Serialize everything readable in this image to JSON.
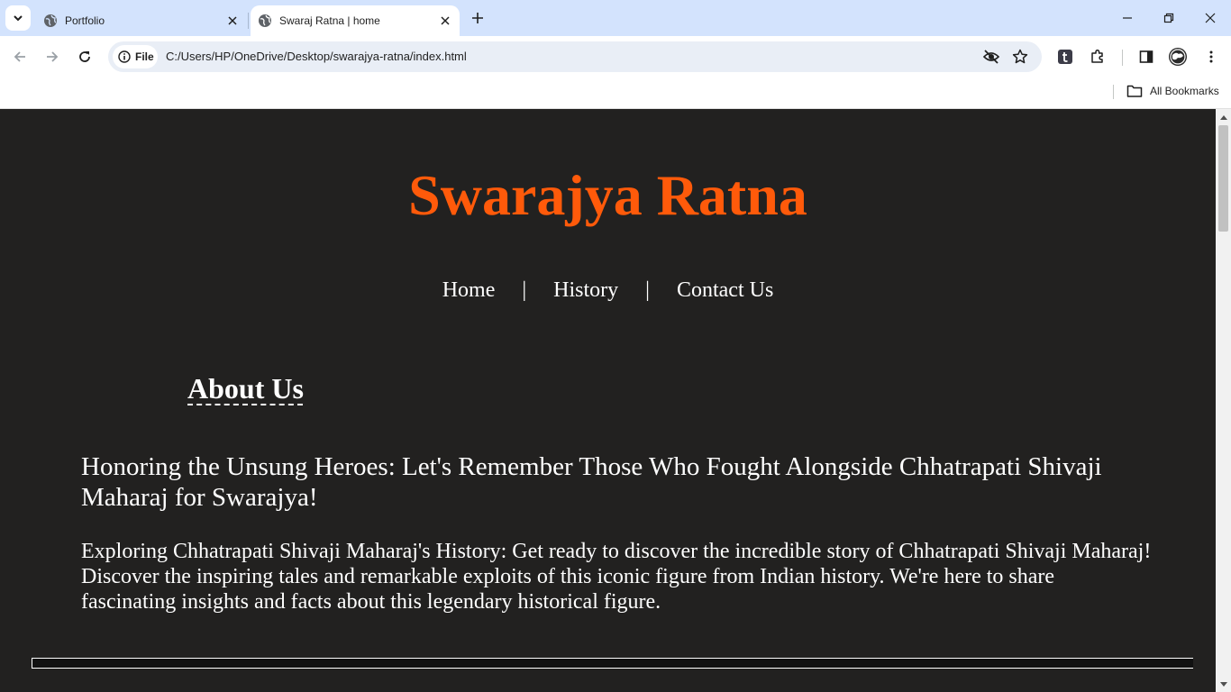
{
  "browser": {
    "tabs": [
      {
        "title": "Portfolio",
        "favicon": "globe-icon",
        "active": false
      },
      {
        "title": "Swaraj Ratna | home",
        "favicon": "globe-icon",
        "active": true
      }
    ],
    "site_chip": "File",
    "url": "C:/Users/HP/OneDrive/Desktop/swarajya-ratna/index.html",
    "bookmarks_label": "All Bookmarks",
    "colors": {
      "tabbar": "#d3e3fd",
      "omnibox": "#e9eef6"
    }
  },
  "page": {
    "site_title": "Swarajya Ratna",
    "nav": {
      "home": "Home",
      "history": "History",
      "contact": "Contact Us",
      "separator": "|"
    },
    "about_heading": "About Us",
    "lead": "Honoring the Unsung Heroes: Let's Remember Those Who Fought Alongside Chhatrapati Shivaji Maharaj for Swarajya!",
    "body": "Exploring Chhatrapati Shivaji Maharaj's History: Get ready to discover the incredible story of Chhatrapati Shivaji Maharaj! Discover the inspiring tales and remarkable exploits of this iconic figure from Indian history. We're here to share fascinating insights and facts about this legendary historical figure.",
    "colors": {
      "background": "#222120",
      "title": "#ff5a0a",
      "text": "#ffffff"
    }
  }
}
